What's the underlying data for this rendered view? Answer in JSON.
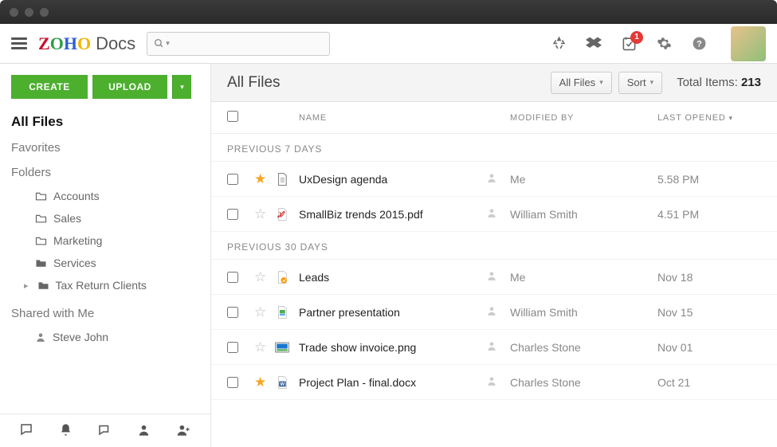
{
  "brand": {
    "name_part": "Docs"
  },
  "search": {
    "placeholder": ""
  },
  "notifications": {
    "count": "1"
  },
  "sidebar": {
    "create_label": "CREATE",
    "upload_label": "UPLOAD",
    "items": {
      "all_files": "All Files",
      "favorites": "Favorites",
      "folders": "Folders",
      "shared": "Shared with Me"
    },
    "folders": [
      {
        "label": "Accounts"
      },
      {
        "label": "Sales"
      },
      {
        "label": "Marketing"
      },
      {
        "label": "Services"
      },
      {
        "label": "Tax Return Clients"
      }
    ],
    "shared_users": [
      {
        "label": "Steve John"
      }
    ]
  },
  "main": {
    "title": "All Files",
    "filter_label": "All Files",
    "sort_label": "Sort",
    "total_label": "Total Items:",
    "total_count": "213",
    "columns": {
      "name": "NAME",
      "modified": "MODIFIED BY",
      "last_opened": "LAST OPENED"
    },
    "sections": [
      {
        "label": "PREVIOUS 7 DAYS",
        "rows": [
          {
            "starred": true,
            "icon": "doc",
            "name": "UxDesign agenda",
            "modified_by": "Me",
            "last": "5.58 PM"
          },
          {
            "starred": false,
            "icon": "pdf",
            "name": "SmallBiz trends 2015.pdf",
            "modified_by": "William Smith",
            "last": "4.51 PM"
          }
        ]
      },
      {
        "label": "PREVIOUS 30 DAYS",
        "rows": [
          {
            "starred": false,
            "icon": "leads",
            "name": "Leads",
            "modified_by": "Me",
            "last": "Nov 18"
          },
          {
            "starred": false,
            "icon": "pres",
            "name": "Partner presentation",
            "modified_by": "William Smith",
            "last": "Nov 15"
          },
          {
            "starred": false,
            "icon": "img",
            "name": "Trade show invoice.png",
            "modified_by": "Charles Stone",
            "last": "Nov 01"
          },
          {
            "starred": true,
            "icon": "word",
            "name": "Project Plan - final.docx",
            "modified_by": "Charles Stone",
            "last": "Oct 21"
          }
        ]
      }
    ]
  }
}
